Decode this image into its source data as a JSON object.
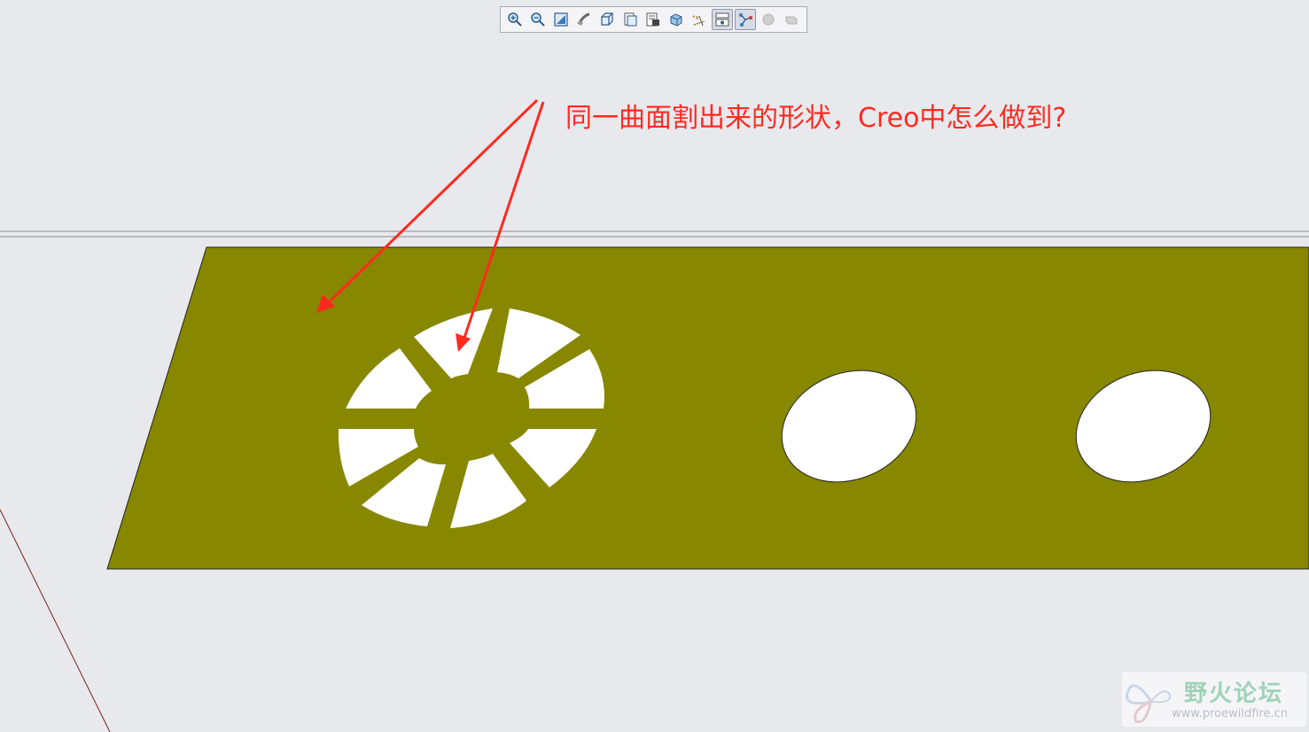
{
  "toolbar": {
    "buttons": [
      {
        "icon": "zoom-in-icon"
      },
      {
        "icon": "zoom-out-icon"
      },
      {
        "icon": "refit-icon"
      },
      {
        "icon": "repaint-icon"
      },
      {
        "icon": "orient-icon"
      },
      {
        "icon": "saved-views-icon"
      },
      {
        "icon": "view-manager-icon"
      },
      {
        "icon": "display-style-icon"
      },
      {
        "icon": "datum-display-icon"
      },
      {
        "icon": "annotation-display-icon",
        "active": true
      },
      {
        "icon": "spin-center-icon",
        "active": true
      },
      {
        "icon": "disabled-circle-icon"
      },
      {
        "icon": "disabled-arrow-icon"
      }
    ]
  },
  "annotation": {
    "text": "同一曲面割出来的形状，Creo中怎么做到?",
    "color": "#ff2a1f"
  },
  "model": {
    "surface_color": "#878700",
    "background_color": "#e8e9ed",
    "cut_color": "#ffffff"
  },
  "watermark": {
    "title": "野火论坛",
    "url": "www.proewildfire.cn"
  }
}
